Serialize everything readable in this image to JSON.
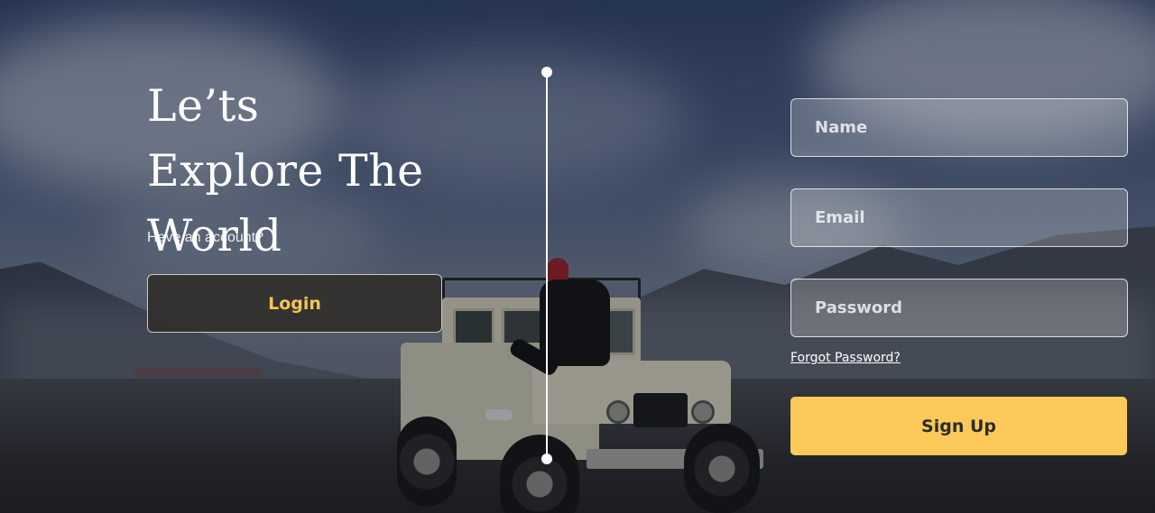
{
  "hero": {
    "headline_line1": "Le’ts",
    "headline_line2": "Explore The",
    "headline_line3": "World",
    "have_account_text": "Have an account?",
    "login_label": "Login"
  },
  "signup_form": {
    "name_placeholder": "Name",
    "email_placeholder": "Email",
    "password_placeholder": "Password",
    "forgot_password_label": "Forgot Password?",
    "signup_label": "Sign Up"
  },
  "colors": {
    "accent_yellow": "#fdc95a",
    "login_text": "#f5c453",
    "login_bg": "#32302e",
    "text_white": "#ffffff"
  }
}
